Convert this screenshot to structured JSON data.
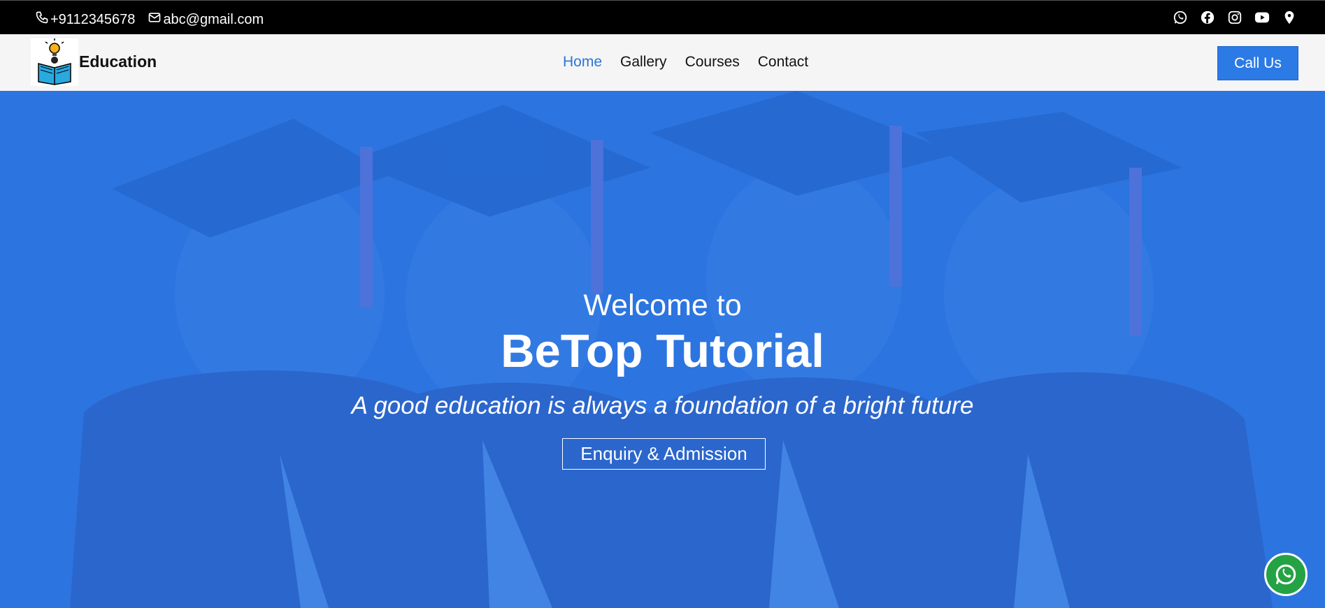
{
  "topbar": {
    "phone": "+9112345678",
    "email": "abc@gmail.com",
    "socials": [
      "whatsapp-icon",
      "facebook-icon",
      "instagram-icon",
      "youtube-icon",
      "location-pin-icon"
    ]
  },
  "nav": {
    "brand": "Education",
    "links": [
      "Home",
      "Gallery",
      "Courses",
      "Contact"
    ],
    "active": "Home",
    "call_button": "Call Us"
  },
  "hero": {
    "welcome": "Welcome to",
    "title": "BeTop Tutorial",
    "tagline": "A good education is always a foundation of a bright future",
    "button": "Enquiry & Admission"
  },
  "colors": {
    "accent": "#2b7ae6",
    "hero_overlay": "#2a74e0",
    "topbar": "#000000",
    "whatsapp": "#25a244"
  }
}
